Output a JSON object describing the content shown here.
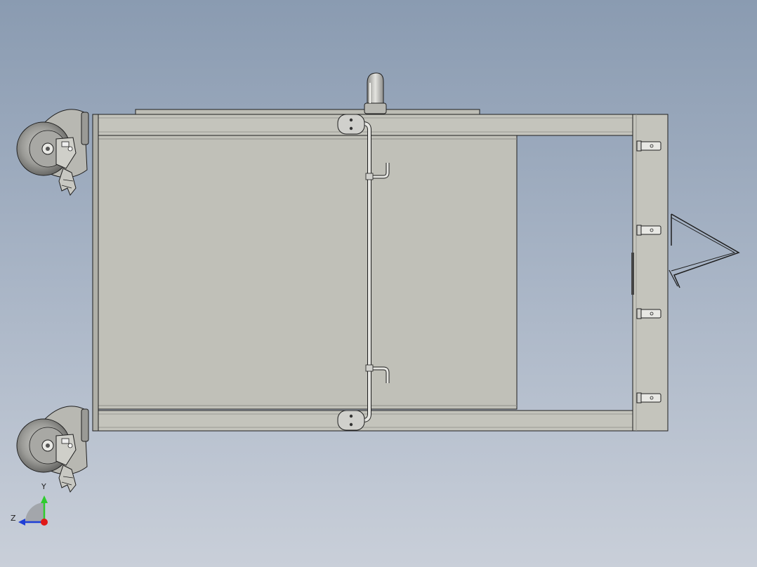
{
  "view": {
    "background_top": "#8a9bb1",
    "background_bottom": "#c9cfd9"
  },
  "colors": {
    "frame_fill": "#c4c4bc",
    "panel_fill": "#c0c0b8",
    "edge": "#1e1e1e",
    "tube_fill": "#dcdcd8",
    "wheel_dark": "#6a6a6a",
    "wheel_light": "#b8b8b4"
  },
  "triad": {
    "y_label": "Y",
    "z_label": "Z",
    "y_color": "#2ecc2e",
    "z_color": "#1f3fd6",
    "x_color": "#e01818"
  },
  "icons": [
    "caster-wheel-icon",
    "coordinate-triad-icon"
  ]
}
